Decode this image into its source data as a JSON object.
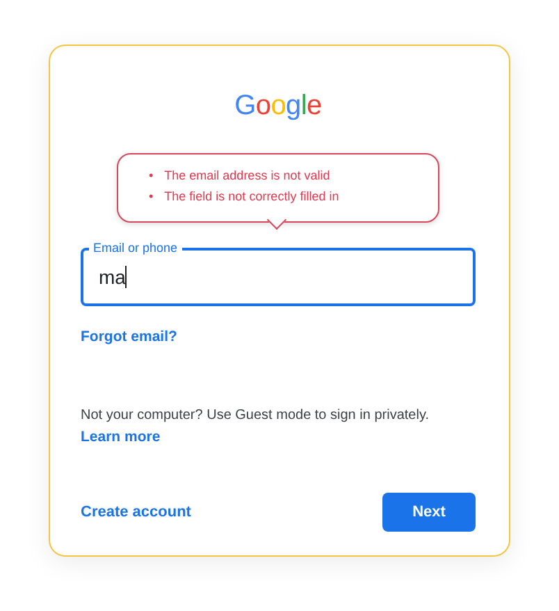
{
  "logo": "Google",
  "error_tooltip": {
    "bullet": "•",
    "messages": [
      "The email address is not valid",
      "The field is not correctly filled in"
    ]
  },
  "email_field": {
    "label": "Email or phone",
    "value": "ma",
    "focused": true
  },
  "forgot_link": "Forgot email?",
  "guest_note": "Not your computer? Use Guest mode to sign in privately.",
  "learn_more_link": "Learn more",
  "create_account_link": "Create account",
  "next_button": "Next"
}
